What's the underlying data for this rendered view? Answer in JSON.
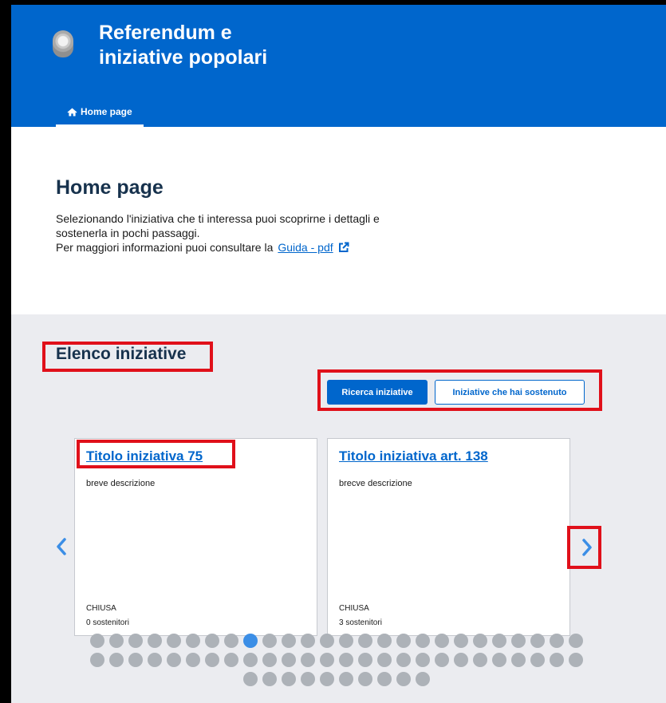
{
  "header": {
    "title_line1": "Referendum e",
    "title_line2": "iniziative popolari",
    "background": "#0066cc",
    "emblem": "emblema-repubblica-italiana",
    "nav": [
      {
        "label": "Home page",
        "icon": "home-icon",
        "active": true
      }
    ]
  },
  "intro": {
    "title": "Home page",
    "line1": "Selezionando l'iniziativa che ti interessa puoi scoprirne i dettagli e",
    "line2": "sostenerla in pochi passaggi.",
    "line3": "Per maggiori informazioni puoi consultare la",
    "guide_link": "Guida - pdf",
    "guide_icon": "external-link-icon"
  },
  "initiatives": {
    "title": "Elenco iniziative",
    "search_button": "Ricerca iniziative",
    "supported_button": "Iniziative che hai sostenuto",
    "cards": [
      {
        "title": "Titolo iniziativa 75",
        "description": "breve descrizione",
        "status": "CHIUSA",
        "supporters": "0 sostenitori"
      },
      {
        "title": "Titolo iniziativa art. 138",
        "description": "brecve descrizione",
        "status": "CHIUSA",
        "supporters": "3 sostenitori"
      }
    ],
    "prev_icon": "chevron-left-icon",
    "next_icon": "chevron-right-icon",
    "pagination": {
      "rows": [
        26,
        26,
        10
      ],
      "active_index": 8
    }
  },
  "colors": {
    "primary": "#0066cc",
    "section_background": "#ebecf0",
    "annotation": "#e0101a",
    "dot": "#adb2b8",
    "dot_active": "#3b8ee6"
  }
}
